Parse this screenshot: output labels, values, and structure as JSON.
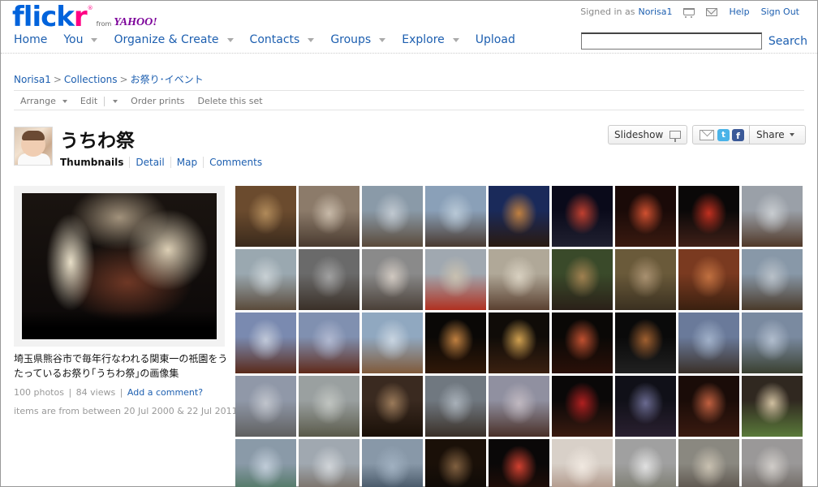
{
  "brand": {
    "name_main": "flick",
    "name_r": "r",
    "reg": "®",
    "from": "from",
    "yahoo": "YAHOO!"
  },
  "topbar": {
    "signed_in": "Signed in as",
    "user": "Norisa1",
    "help": "Help",
    "sign_out": "Sign Out"
  },
  "nav": {
    "home": "Home",
    "you": "You",
    "organize": "Organize & Create",
    "contacts": "Contacts",
    "groups": "Groups",
    "explore": "Explore",
    "upload": "Upload"
  },
  "search": {
    "value": "",
    "button": "Search"
  },
  "breadcrumb": {
    "user": "Norisa1",
    "collections": "Collections",
    "current": "お祭り･イベント",
    "sep": ">"
  },
  "actions": {
    "arrange": "Arrange",
    "edit": "Edit",
    "order_prints": "Order prints",
    "delete_set": "Delete this set"
  },
  "set": {
    "title": "うちわ祭",
    "tabs": {
      "thumbnails": "Thumbnails",
      "detail": "Detail",
      "map": "Map",
      "comments": "Comments"
    },
    "slideshow": "Slideshow",
    "share": "Share",
    "description": "埼玉県熊谷市で毎年行なわれる関東一の祇園をうたっているお祭り｢うちわ祭｣の画像集",
    "photos": "100 photos",
    "views": "84 views",
    "add_comment": "Add a comment?",
    "date_range": "items are from between 20 Jul 2000 & 22 Jul 2011."
  },
  "thumbnails": [
    [
      "#6b4b2e",
      "#b08a5a",
      "#3a2a1c"
    ],
    [
      "#8c7b6a",
      "#c7b9a8",
      "#4a3b30"
    ],
    [
      "#8a9aa8",
      "#c0c8d0",
      "#5a4a3a"
    ],
    [
      "#8aa0b8",
      "#b8c8d6",
      "#4a3a30"
    ],
    [
      "#1a2a5a",
      "#c08040",
      "#2a1a10"
    ],
    [
      "#0a0a1a",
      "#c04030",
      "#202030"
    ],
    [
      "#1a0a08",
      "#d05030",
      "#3a1a10"
    ],
    [
      "#0a0808",
      "#c03020",
      "#402018"
    ],
    [
      "#9aa0a8",
      "#c8ccd0",
      "#503828"
    ],
    [
      "#9aa8b0",
      "#c8d0d4",
      "#5a4a3a"
    ],
    [
      "#6a6a6a",
      "#a0a0a0",
      "#3a3028"
    ],
    [
      "#8a8a8a",
      "#d0c8c0",
      "#4a4038"
    ],
    [
      "#a0a8b0",
      "#c8c0b0",
      "#b03020"
    ],
    [
      "#b0a898",
      "#d8d0c0",
      "#5a4030"
    ],
    [
      "#3a4a2a",
      "#a08050",
      "#2a2018"
    ],
    [
      "#6a5a3a",
      "#a89070",
      "#3a3020"
    ],
    [
      "#7a3a20",
      "#c07040",
      "#3a2010"
    ],
    [
      "#8898a8",
      "#b8c0c8",
      "#4a3a2a"
    ],
    [
      "#7a8ab0",
      "#c0c8d8",
      "#5a2a1a"
    ],
    [
      "#8090b0",
      "#b0b8d0",
      "#602a1a"
    ],
    [
      "#90a8c0",
      "#c8d4e0",
      "#805a3a"
    ],
    [
      "#0a0806",
      "#c08040",
      "#301808"
    ],
    [
      "#100c08",
      "#d0a050",
      "#3a2010"
    ],
    [
      "#0a0806",
      "#c05030",
      "#2a1008"
    ],
    [
      "#0a0a0a",
      "#a06030",
      "#202020"
    ],
    [
      "#6a7a9a",
      "#a0b0c8",
      "#3a3028"
    ],
    [
      "#7a8aa0",
      "#b0bccc",
      "#3a4030"
    ],
    [
      "#9098a8",
      "#c0c4cc",
      "#606060"
    ],
    [
      "#9aa0a0",
      "#c0c4c0",
      "#5a5a4a"
    ],
    [
      "#3a2a20",
      "#9a7a5a",
      "#1a1008"
    ],
    [
      "#707880",
      "#a8b0b8",
      "#3a3028"
    ],
    [
      "#9090a0",
      "#c0b8c0",
      "#4a3028"
    ],
    [
      "#0a0808",
      "#b02020",
      "#3a1a10"
    ],
    [
      "#101018",
      "#6a6a90",
      "#2a2030"
    ],
    [
      "#1a0c08",
      "#c06040",
      "#3a1a10"
    ],
    [
      "#302820",
      "#d0c0a0",
      "#5a7a3a"
    ],
    [
      "#8a9aa8",
      "#c0ccd8",
      "#3a6a4a"
    ],
    [
      "#a0a8b0",
      "#d0d4d8",
      "#6a5a4a"
    ],
    [
      "#8898a8",
      "#a0b0c0",
      "#2a3a4a"
    ],
    [
      "#1a1008",
      "#806040",
      "#0a0806"
    ],
    [
      "#0a0808",
      "#d04030",
      "#2a1008"
    ],
    [
      "#d8d0c8",
      "#f0e8e0",
      "#a08070"
    ],
    [
      "#a0a0a0",
      "#e0e0e0",
      "#707060"
    ],
    [
      "#8a8880",
      "#c8c0b0",
      "#4a4038"
    ],
    [
      "#9a9898",
      "#d0ccc8",
      "#605850"
    ]
  ]
}
